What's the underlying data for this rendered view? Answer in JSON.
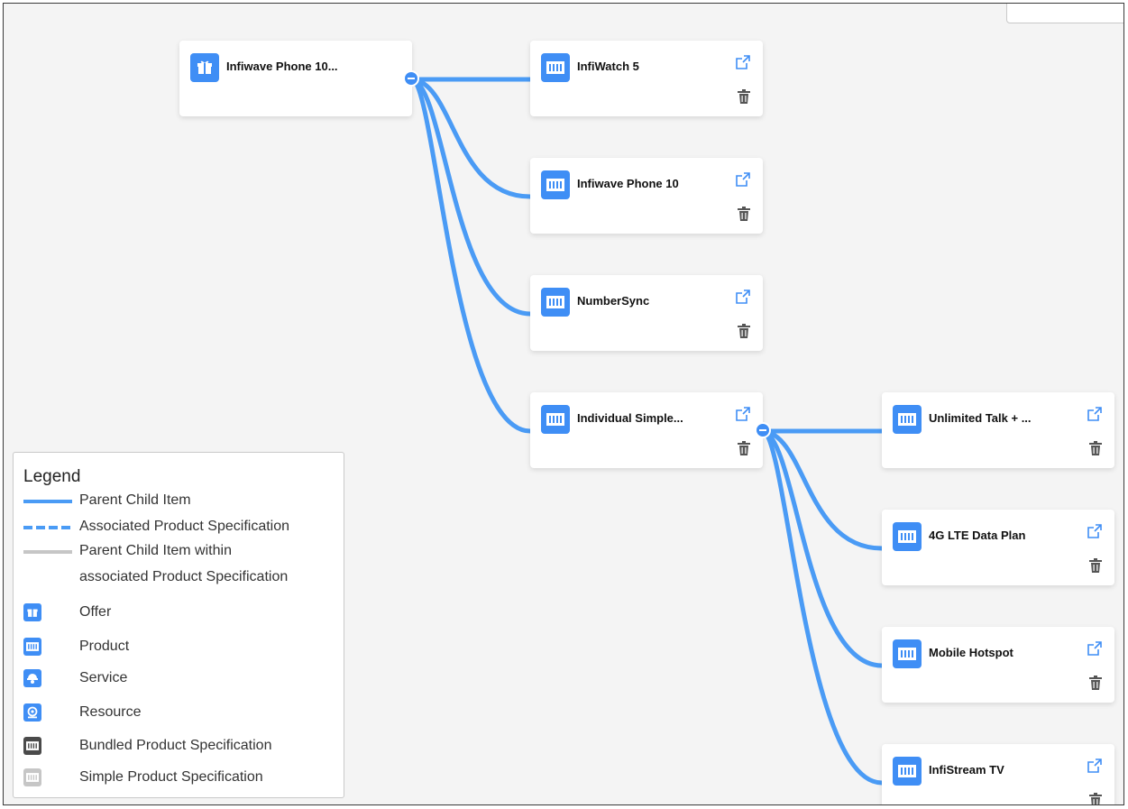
{
  "colors": {
    "link": "#4a9bf5",
    "icon_blue": "#3f8ef5",
    "bundled": "#4a4a4a",
    "simple": "#c6c6c6",
    "card": "#ffffff",
    "canvas": "#f4f4f4"
  },
  "nodes": {
    "root": {
      "label": "Infiwave Phone 10...",
      "icon": "offer-icon"
    },
    "infiwatch": {
      "label": "InfiWatch 5",
      "icon": "product-icon"
    },
    "infiwave_phone": {
      "label": "Infiwave Phone 10",
      "icon": "product-icon"
    },
    "numbersync": {
      "label": "NumberSync",
      "icon": "product-icon"
    },
    "individual_simple": {
      "label": "Individual Simple...",
      "icon": "product-icon"
    },
    "unlimited_talk": {
      "label": "Unlimited Talk + ...",
      "icon": "product-icon"
    },
    "lte_plan": {
      "label": "4G LTE Data Plan",
      "icon": "product-icon"
    },
    "mobile_hotspot": {
      "label": "Mobile Hotspot",
      "icon": "product-icon"
    },
    "infistream": {
      "label": "InfiStream TV",
      "icon": "product-icon"
    }
  },
  "legend": {
    "title": "Legend",
    "lines": [
      {
        "label": "Parent Child Item",
        "style": "solid",
        "color": "#4a9bf5"
      },
      {
        "label": "Associated Product Specification",
        "style": "dashed",
        "color": "#4a9bf5"
      },
      {
        "label": "Parent Child Item within",
        "style": "solid",
        "color": "#c6c6c6"
      },
      {
        "label": "associated Product Specification",
        "style": "none",
        "color": ""
      }
    ],
    "icons": [
      {
        "label": "Offer",
        "icon": "offer-icon",
        "color": "#3f8ef5"
      },
      {
        "label": "Product",
        "icon": "product-icon",
        "color": "#3f8ef5"
      },
      {
        "label": "Service",
        "icon": "service-icon",
        "color": "#3f8ef5"
      },
      {
        "label": "Resource",
        "icon": "resource-icon",
        "color": "#3f8ef5"
      },
      {
        "label": "Bundled Product Specification",
        "icon": "bundled-spec-icon",
        "color": "#4a4a4a"
      },
      {
        "label": "Simple Product Specification",
        "icon": "simple-spec-icon",
        "color": "#c6c6c6"
      }
    ]
  }
}
